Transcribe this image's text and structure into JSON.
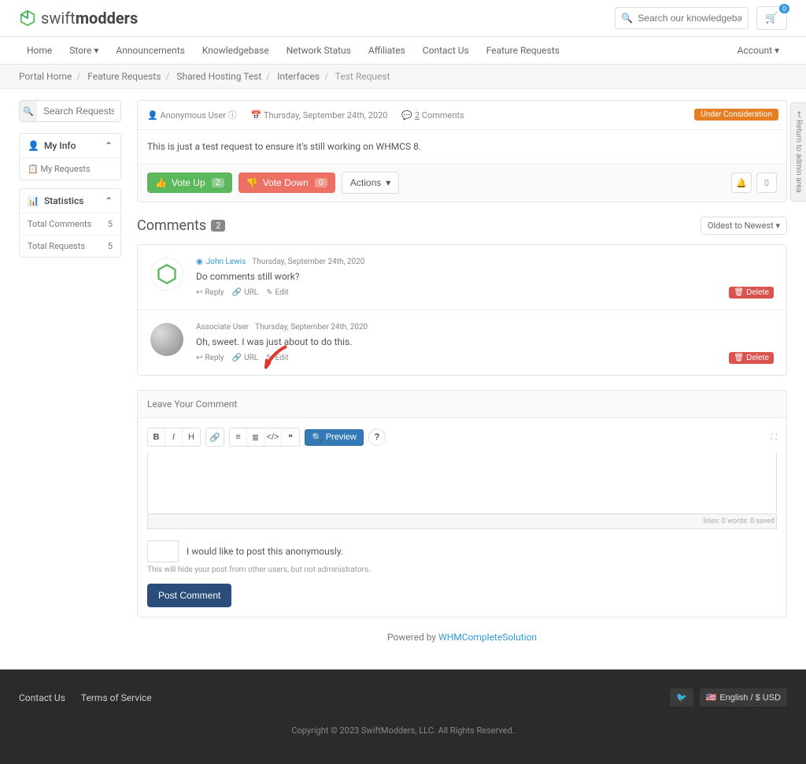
{
  "header": {
    "logo": {
      "part1": "swift",
      "part2": "modders"
    },
    "search_placeholder": "Search our knowledgebase...",
    "cart_count": "0"
  },
  "nav": {
    "items": [
      "Home",
      "Store",
      "Announcements",
      "Knowledgebase",
      "Network Status",
      "Affiliates",
      "Contact Us",
      "Feature Requests"
    ],
    "account": "Account"
  },
  "breadcrumb": {
    "items": [
      "Portal Home",
      "Feature Requests",
      "Shared Hosting Test",
      "Interfaces"
    ],
    "current": "Test Request"
  },
  "sidebar": {
    "search_placeholder": "Search Requests...",
    "myinfo": {
      "title": "My Info",
      "items": [
        {
          "label": "My Requests"
        }
      ]
    },
    "stats": {
      "title": "Statistics",
      "items": [
        {
          "label": "Total Comments",
          "count": "5"
        },
        {
          "label": "Total Requests",
          "count": "5"
        }
      ]
    }
  },
  "request": {
    "author": "Anonymous User",
    "date": "Thursday, September 24th, 2020",
    "comments_count": "2",
    "comments_label": "Comments",
    "status": "Under Consideration",
    "body": "This is just a test request to ensure it's still working on WHMCS 8.",
    "vote_up": "Vote Up",
    "vote_up_count": "2",
    "vote_down": "Vote Down",
    "vote_down_count": "0",
    "actions": "Actions",
    "bell_count": "0"
  },
  "comments": {
    "title": "Comments",
    "badge": "2",
    "sort": "Oldest to Newest",
    "items": [
      {
        "user": "John Lewis",
        "date": "Thursday, September 24th, 2020",
        "text": "Do comments still work?",
        "reply": "Reply",
        "url": "URL",
        "edit": "Edit",
        "delete": "Delete"
      },
      {
        "user": "Associate User",
        "date": "Thursday, September 24th, 2020",
        "text": "Oh, sweet. I was just about to do this.",
        "reply": "Reply",
        "url": "URL",
        "edit": "Edit",
        "delete": "Delete"
      }
    ]
  },
  "leave": {
    "header": "Leave Your Comment",
    "preview": "Preview",
    "stats": "lines: 0   words: 0   saved",
    "anon_label": "I would like to post this anonymously.",
    "anon_help": "This will hide your post from other users, but not administrators.",
    "post_btn": "Post Comment"
  },
  "powered": {
    "label": "Powered by ",
    "link": "WHMCompleteSolution"
  },
  "footer": {
    "links": [
      "Contact Us",
      "Terms of Service"
    ],
    "lang": "English / $ USD",
    "copyright": "Copyright © 2023 SwiftModders, LLC. All Rights Reserved."
  },
  "return_tab": "Return to admin area"
}
